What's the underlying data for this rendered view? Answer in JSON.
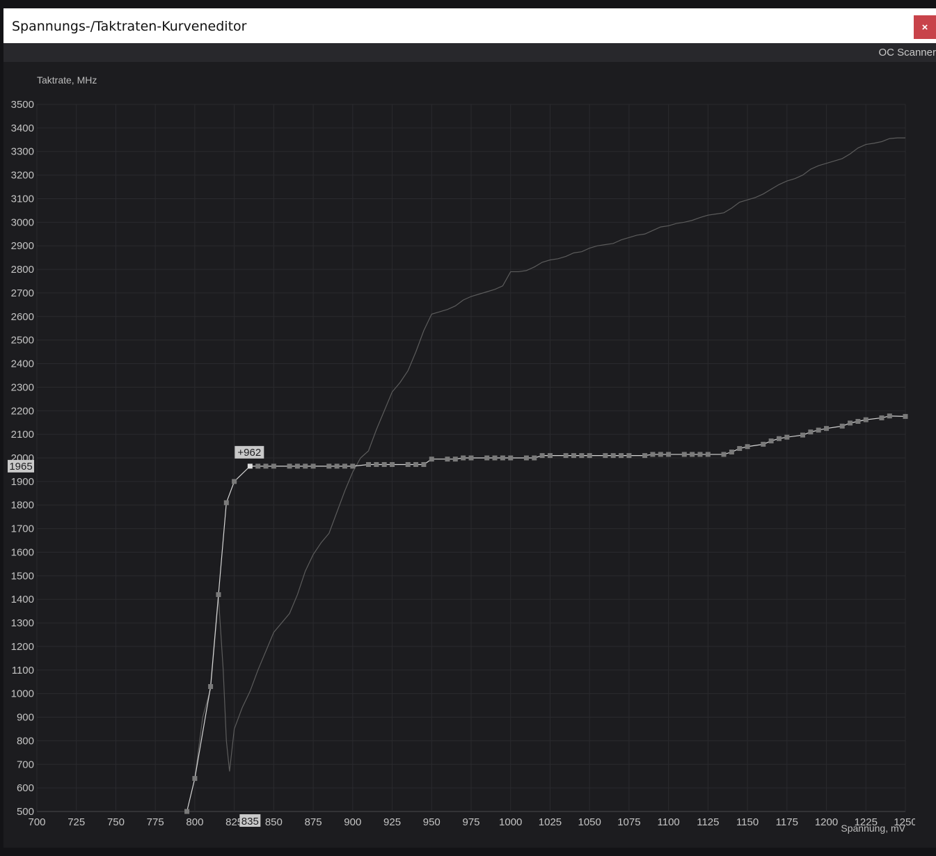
{
  "window": {
    "title": "Spannungs-/Taktraten-Kurveneditor",
    "close_label": "×"
  },
  "toolbar": {
    "oc_scanner_label": "OC Scanner"
  },
  "chart_data": {
    "type": "line",
    "ylabel": "Taktrate, MHz",
    "xlabel": "Spannung, mV",
    "xlim": [
      700,
      1250
    ],
    "ylim": [
      500,
      3500
    ],
    "x_ticks": [
      700,
      725,
      750,
      775,
      800,
      825,
      850,
      875,
      900,
      925,
      950,
      975,
      1000,
      1025,
      1050,
      1075,
      1100,
      1125,
      1150,
      1175,
      1200,
      1225,
      1250
    ],
    "y_ticks": [
      500,
      600,
      700,
      800,
      900,
      1000,
      1100,
      1200,
      1300,
      1400,
      1500,
      1600,
      1700,
      1800,
      1900,
      2000,
      2100,
      2200,
      2300,
      2400,
      2500,
      2600,
      2700,
      2800,
      2900,
      3000,
      3100,
      3200,
      3300,
      3400,
      3500
    ],
    "grid": true,
    "colors": {
      "curve": "#d6d6d6",
      "points": "#7a7a7a",
      "selected_point": "#e0e0e0",
      "reference": "#5c5c5c",
      "grid": "#2a2a2e",
      "label_bg": "#c9c9c9"
    },
    "selection": {
      "voltage": 835,
      "clock": 1965,
      "offset": "+962",
      "voltage_label": "835",
      "clock_label": "1965"
    },
    "series": [
      {
        "role": "curve-points",
        "x": [
          795,
          800,
          810,
          815,
          820,
          825,
          835,
          840,
          845,
          850,
          860,
          865,
          870,
          875,
          885,
          890,
          895,
          900,
          910,
          915,
          920,
          925,
          935,
          940,
          945,
          950,
          960,
          965,
          970,
          975,
          985,
          990,
          995,
          1000,
          1010,
          1015,
          1020,
          1025,
          1035,
          1040,
          1045,
          1050,
          1060,
          1065,
          1070,
          1075,
          1085,
          1090,
          1095,
          1100,
          1110,
          1115,
          1120,
          1125,
          1135,
          1140,
          1145,
          1150,
          1160,
          1165,
          1170,
          1175,
          1185,
          1190,
          1195,
          1200,
          1210,
          1215,
          1220,
          1225,
          1235,
          1240,
          1250
        ],
        "y": [
          500,
          640,
          1030,
          1420,
          1810,
          1900,
          1965,
          1965,
          1965,
          1965,
          1965,
          1965,
          1965,
          1965,
          1965,
          1965,
          1965,
          1965,
          1972,
          1972,
          1972,
          1972,
          1972,
          1972,
          1972,
          1995,
          1995,
          1995,
          2000,
          2000,
          2000,
          2000,
          2000,
          2000,
          2000,
          2000,
          2010,
          2010,
          2010,
          2010,
          2010,
          2010,
          2010,
          2010,
          2010,
          2010,
          2010,
          2015,
          2015,
          2015,
          2015,
          2015,
          2015,
          2015,
          2015,
          2025,
          2040,
          2048,
          2058,
          2072,
          2082,
          2088,
          2097,
          2110,
          2118,
          2125,
          2135,
          2148,
          2155,
          2162,
          2170,
          2178,
          2176
        ]
      },
      {
        "role": "reference-curve",
        "x": [
          800,
          805,
          810,
          815,
          818,
          820,
          822,
          825,
          830,
          835,
          840,
          845,
          850,
          855,
          860,
          865,
          870,
          875,
          880,
          885,
          890,
          895,
          900,
          905,
          910,
          915,
          920,
          925,
          930,
          935,
          940,
          945,
          950,
          955,
          960,
          965,
          970,
          975,
          980,
          985,
          990,
          995,
          1000,
          1005,
          1010,
          1015,
          1020,
          1025,
          1030,
          1035,
          1040,
          1045,
          1050,
          1055,
          1060,
          1065,
          1070,
          1075,
          1080,
          1085,
          1090,
          1095,
          1100,
          1105,
          1110,
          1115,
          1120,
          1125,
          1130,
          1135,
          1140,
          1145,
          1150,
          1155,
          1160,
          1165,
          1170,
          1175,
          1180,
          1185,
          1190,
          1195,
          1200,
          1205,
          1210,
          1215,
          1220,
          1225,
          1230,
          1235,
          1240,
          1245,
          1250
        ],
        "y": [
          640,
          900,
          1020,
          1410,
          1100,
          800,
          670,
          850,
          940,
          1010,
          1100,
          1180,
          1260,
          1300,
          1340,
          1420,
          1520,
          1590,
          1640,
          1680,
          1770,
          1860,
          1940,
          2000,
          2030,
          2120,
          2200,
          2280,
          2320,
          2370,
          2450,
          2540,
          2610,
          2620,
          2630,
          2645,
          2670,
          2685,
          2695,
          2705,
          2715,
          2730,
          2790,
          2790,
          2795,
          2810,
          2830,
          2840,
          2845,
          2855,
          2870,
          2875,
          2890,
          2900,
          2905,
          2910,
          2925,
          2935,
          2945,
          2950,
          2965,
          2980,
          2985,
          2995,
          3000,
          3008,
          3020,
          3030,
          3035,
          3040,
          3060,
          3085,
          3095,
          3105,
          3120,
          3140,
          3160,
          3175,
          3185,
          3200,
          3225,
          3240,
          3250,
          3260,
          3270,
          3290,
          3315,
          3330,
          3335,
          3342,
          3355,
          3358,
          3358
        ]
      }
    ]
  }
}
